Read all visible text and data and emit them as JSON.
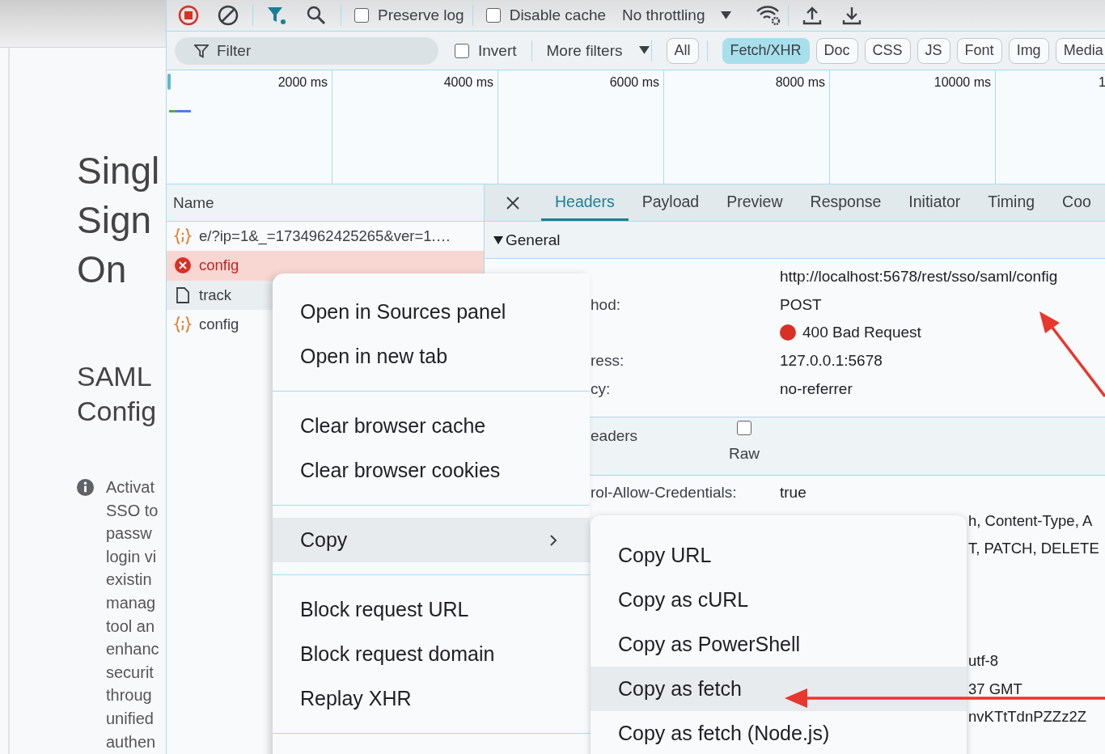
{
  "page": {
    "title": [
      "Singl",
      "Sign",
      "On"
    ],
    "subtitle": [
      "SAML",
      "Config"
    ],
    "note": [
      "Activat",
      "SSO to",
      "passw",
      "login vi",
      "existin",
      "manag",
      "tool an",
      "enhanc",
      "securit",
      "throug",
      "unified",
      "authen"
    ]
  },
  "toolbar": {
    "preserve_log": {
      "label": "Preserve log",
      "checked": false
    },
    "disable_cache": {
      "label": "Disable cache",
      "checked": false
    },
    "throttling": "No throttling"
  },
  "filter_bar": {
    "placeholder": "Filter",
    "invert": {
      "label": "Invert",
      "checked": false
    },
    "more_filters": "More filters",
    "types": [
      {
        "label": "All",
        "selected": false
      },
      {
        "label": "Fetch/XHR",
        "selected": true
      },
      {
        "label": "Doc",
        "selected": false
      },
      {
        "label": "CSS",
        "selected": false
      },
      {
        "label": "JS",
        "selected": false
      },
      {
        "label": "Font",
        "selected": false
      },
      {
        "label": "Img",
        "selected": false
      },
      {
        "label": "Media",
        "selected": false
      }
    ]
  },
  "timeline": {
    "ticks": [
      "2000 ms",
      "4000 ms",
      "6000 ms",
      "8000 ms",
      "10000 ms",
      "1"
    ]
  },
  "requests": {
    "column": "Name",
    "rows": [
      {
        "kind": "fetch",
        "name": "e/?ip=1&_=1734962425265&ver=1.…",
        "selected": false
      },
      {
        "kind": "error",
        "name": "config",
        "selected": true
      },
      {
        "kind": "document",
        "name": "track",
        "selected": false
      },
      {
        "kind": "fetch",
        "name": "config",
        "selected": false
      }
    ]
  },
  "details": {
    "tabs": [
      {
        "label": "Headers",
        "selected": true
      },
      {
        "label": "Payload",
        "selected": false
      },
      {
        "label": "Preview",
        "selected": false
      },
      {
        "label": "Response",
        "selected": false
      },
      {
        "label": "Initiator",
        "selected": false
      },
      {
        "label": "Timing",
        "selected": false
      },
      {
        "label": "Coo",
        "selected": false
      }
    ],
    "general": {
      "title": "General",
      "expanded": true,
      "rows": [
        {
          "kind": "text",
          "value": "http://localhost:5678/rest/sso/saml/config"
        },
        {
          "kind": "text",
          "label": "hod:",
          "value": "POST"
        },
        {
          "kind": "status",
          "value": "400 Bad Request"
        },
        {
          "kind": "text",
          "label": "ress:",
          "value": "127.0.0.1:5678"
        },
        {
          "kind": "text",
          "label": "cy:",
          "value": "no-referrer"
        }
      ]
    },
    "response_headers": {
      "title": "eaders",
      "raw": {
        "label": "Raw",
        "checked": false
      },
      "rows": [
        {
          "label": "rol-Allow-Credentials:",
          "value": "true"
        },
        {
          "tail": "h, Content-Type, A"
        },
        {
          "tail": "T, PATCH, DELETE"
        }
      ],
      "more_rows": [
        {
          "tail": "utf-8"
        },
        {
          "tail": "37 GMT"
        },
        {
          "tail": "nvKTtTdnPZZz2Z"
        }
      ]
    }
  },
  "context_menu": {
    "groups": [
      [
        {
          "label": "Open in Sources panel",
          "selected": false,
          "has_submenu": false
        },
        {
          "label": "Open in new tab",
          "selected": false,
          "has_submenu": false
        }
      ],
      [
        {
          "label": "Clear browser cache",
          "selected": false,
          "has_submenu": false
        },
        {
          "label": "Clear browser cookies",
          "selected": false,
          "has_submenu": false
        }
      ],
      [
        {
          "label": "Copy",
          "selected": true,
          "has_submenu": true
        }
      ],
      [
        {
          "label": "Block request URL",
          "selected": false,
          "has_submenu": false
        },
        {
          "label": "Block request domain",
          "selected": false,
          "has_submenu": false
        },
        {
          "label": "Replay XHR",
          "selected": false,
          "has_submenu": false
        }
      ]
    ]
  },
  "copy_submenu": {
    "items": [
      {
        "label": "Copy URL",
        "selected": false
      },
      {
        "label": "Copy as cURL",
        "selected": false
      },
      {
        "label": "Copy as PowerShell",
        "selected": false
      },
      {
        "label": "Copy as fetch",
        "selected": true
      },
      {
        "label": "Copy as fetch (Node.js)",
        "selected": false
      }
    ]
  }
}
